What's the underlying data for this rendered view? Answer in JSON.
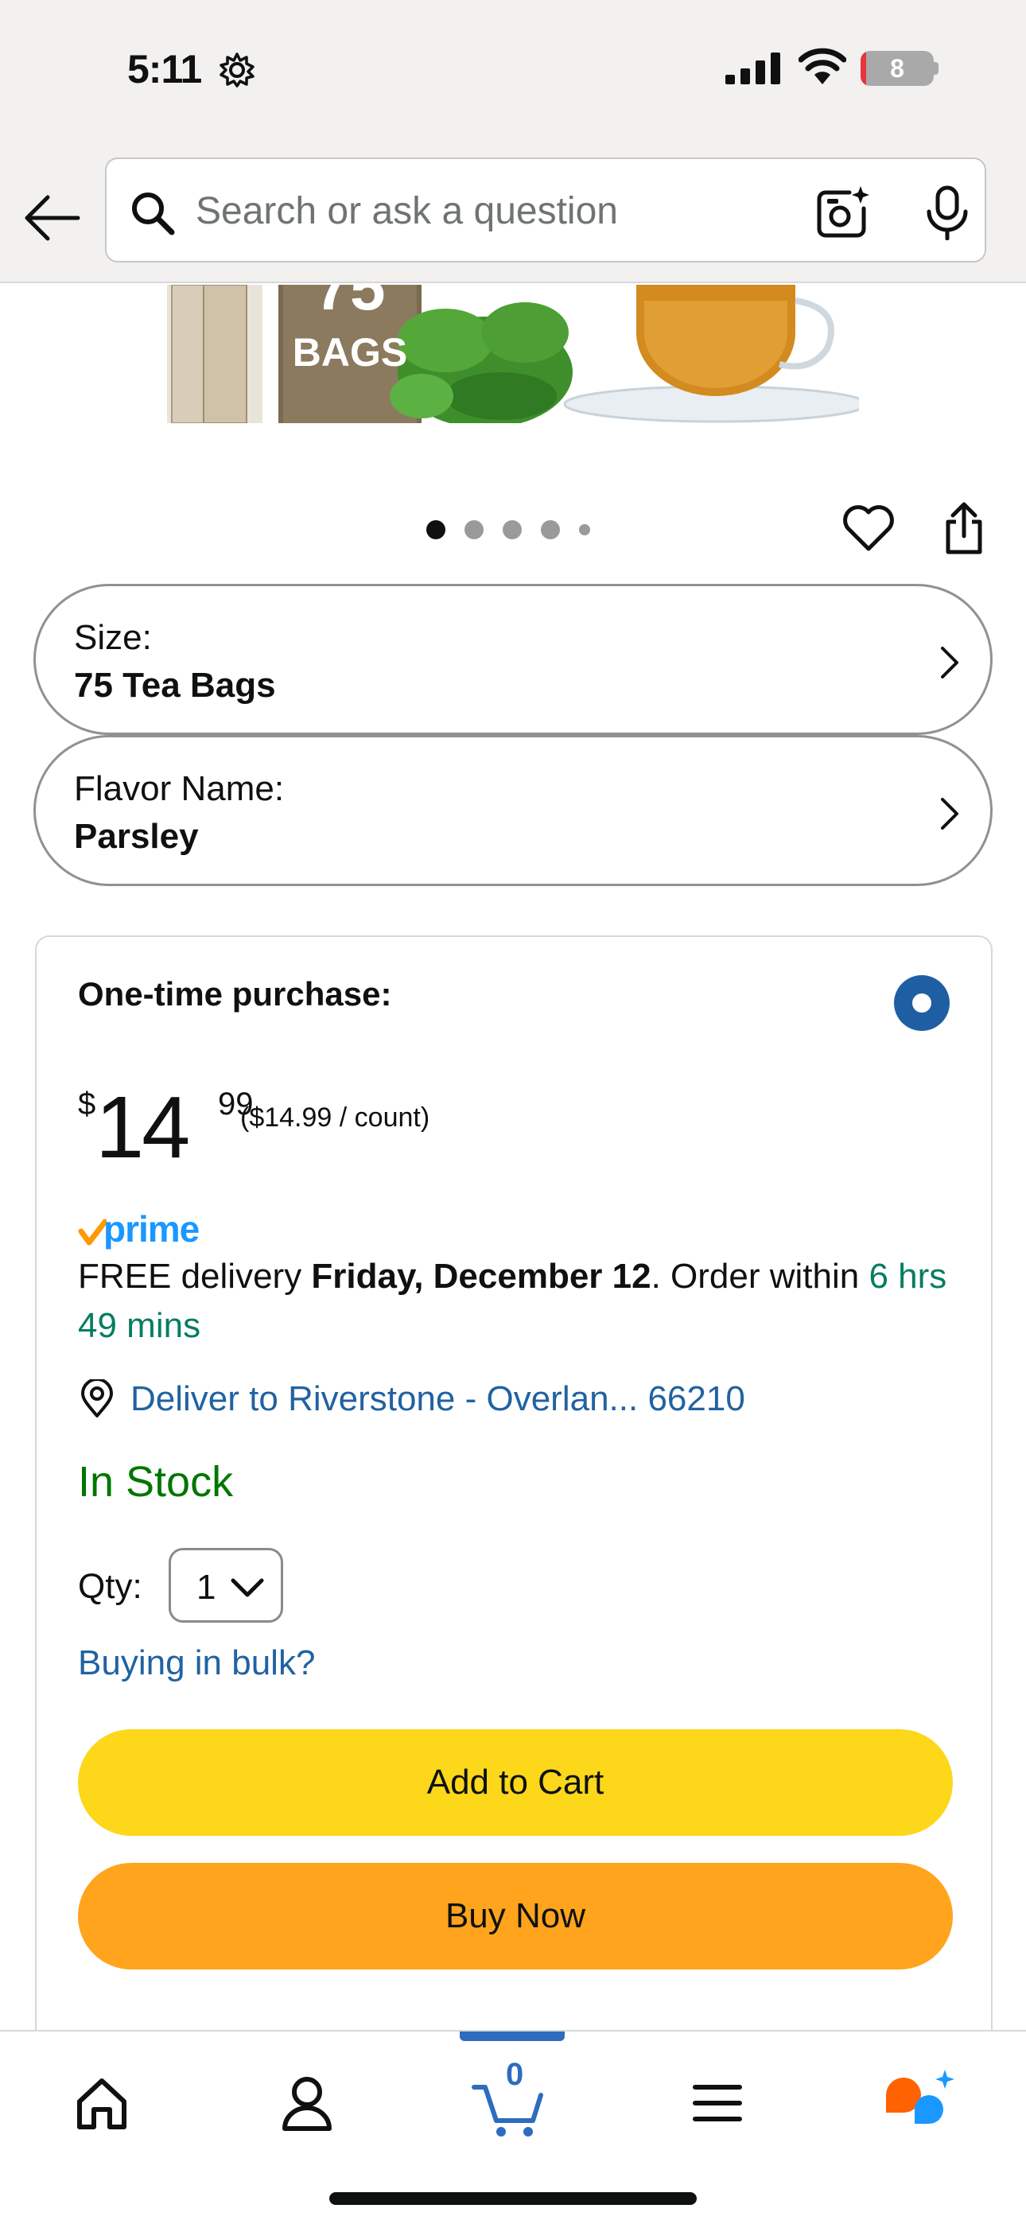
{
  "status_bar": {
    "time": "5:11",
    "battery_level": "8",
    "battery_fraction": 0.08,
    "icons": [
      "gear-icon",
      "cellular-signal-icon",
      "wifi-icon",
      "battery-icon"
    ]
  },
  "search": {
    "placeholder": "Search or ask a question",
    "value": "",
    "icons": [
      "back-arrow-icon",
      "search-icon",
      "camera-icon",
      "microphone-icon"
    ]
  },
  "product_image": {
    "badge_number": "75",
    "badge_text": "BAGS"
  },
  "carousel": {
    "total_dots": 5,
    "active_index": 0
  },
  "variations": [
    {
      "label": "Size:",
      "value": "75 Tea Bags"
    },
    {
      "label": "Flavor Name:",
      "value": "Parsley"
    }
  ],
  "buy_box": {
    "title": "One-time purchase:",
    "price_symbol": "$",
    "price_whole": "14",
    "price_fraction": "99",
    "price_per_unit": "($14.99 / count)",
    "prime_label": "prime",
    "delivery_prefix": "FREE delivery ",
    "delivery_date": "Friday, December 12",
    "delivery_mid": ". Order within ",
    "delivery_countdown": "6 hrs 49 mins",
    "deliver_to": "Deliver to Riverstone - Overlan... 66210",
    "stock_status": "In Stock",
    "qty_label": "Qty:",
    "qty_value": "1",
    "bulk_link": "Buying in bulk?",
    "add_to_cart": "Add to Cart",
    "buy_now": "Buy Now"
  },
  "bottom_nav": {
    "items": [
      "home-icon",
      "account-icon",
      "cart-icon",
      "menu-icon",
      "rufus-icon"
    ],
    "cart_count": "0",
    "active": "cart-icon"
  },
  "colors": {
    "accent_blue": "#1f5ea3",
    "link_blue": "#2162a1",
    "prime_blue": "#1a98ff",
    "in_stock_green": "#007600",
    "countdown_green": "#067d62",
    "add_to_cart_yellow": "#fcd71a",
    "buy_now_orange": "#ffa41c"
  }
}
